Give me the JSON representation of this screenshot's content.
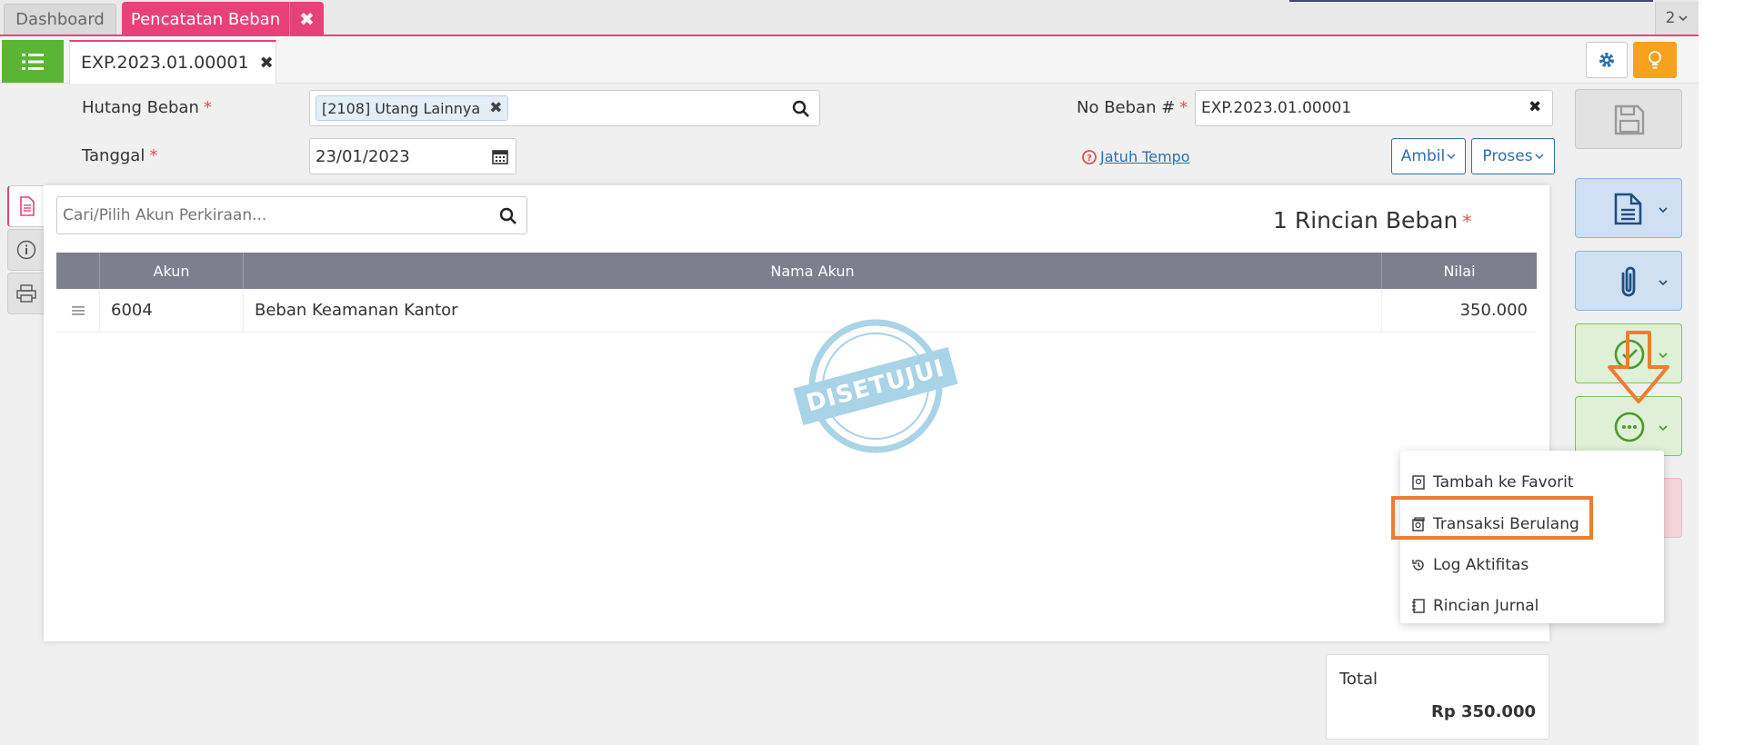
{
  "tabs": {
    "dashboard": "Dashboard",
    "active": "Pencatatan Beban",
    "count": "2"
  },
  "document_tab": {
    "label": "EXP.2023.01.00001"
  },
  "form": {
    "hutang_beban_label": "Hutang Beban",
    "hutang_beban_value": "[2108] Utang Lainnya",
    "no_beban_label": "No Beban #",
    "no_beban_value": "EXP.2023.01.00001",
    "tanggal_label": "Tanggal",
    "tanggal_value": "23/01/2023",
    "jatuh_tempo_link": "Jatuh Tempo",
    "ambil_button": "Ambil",
    "proses_button": "Proses",
    "required_mark": "*"
  },
  "detail": {
    "search_placeholder": "Cari/Pilih Akun Perkiraan...",
    "count_title": "1 Rincian Beban",
    "columns": [
      "Akun",
      "Nama Akun",
      "Nilai"
    ],
    "rows": [
      {
        "akun": "6004",
        "nama_akun": "Beban Keamanan Kantor",
        "nilai": "350.000"
      }
    ],
    "stamp": "DISETUJUI"
  },
  "menu": {
    "items": [
      "Tambah ke Favorit",
      "Transaksi Berulang",
      "Log Aktifitas",
      "Rincian Jurnal"
    ]
  },
  "total": {
    "label": "Total",
    "value": "Rp 350.000"
  },
  "colors": {
    "accent_pink": "#e8417a",
    "green": "#5ab534",
    "orange": "#ed7d31",
    "header_grey": "#7d7f8f",
    "link_blue": "#2c6fae"
  }
}
